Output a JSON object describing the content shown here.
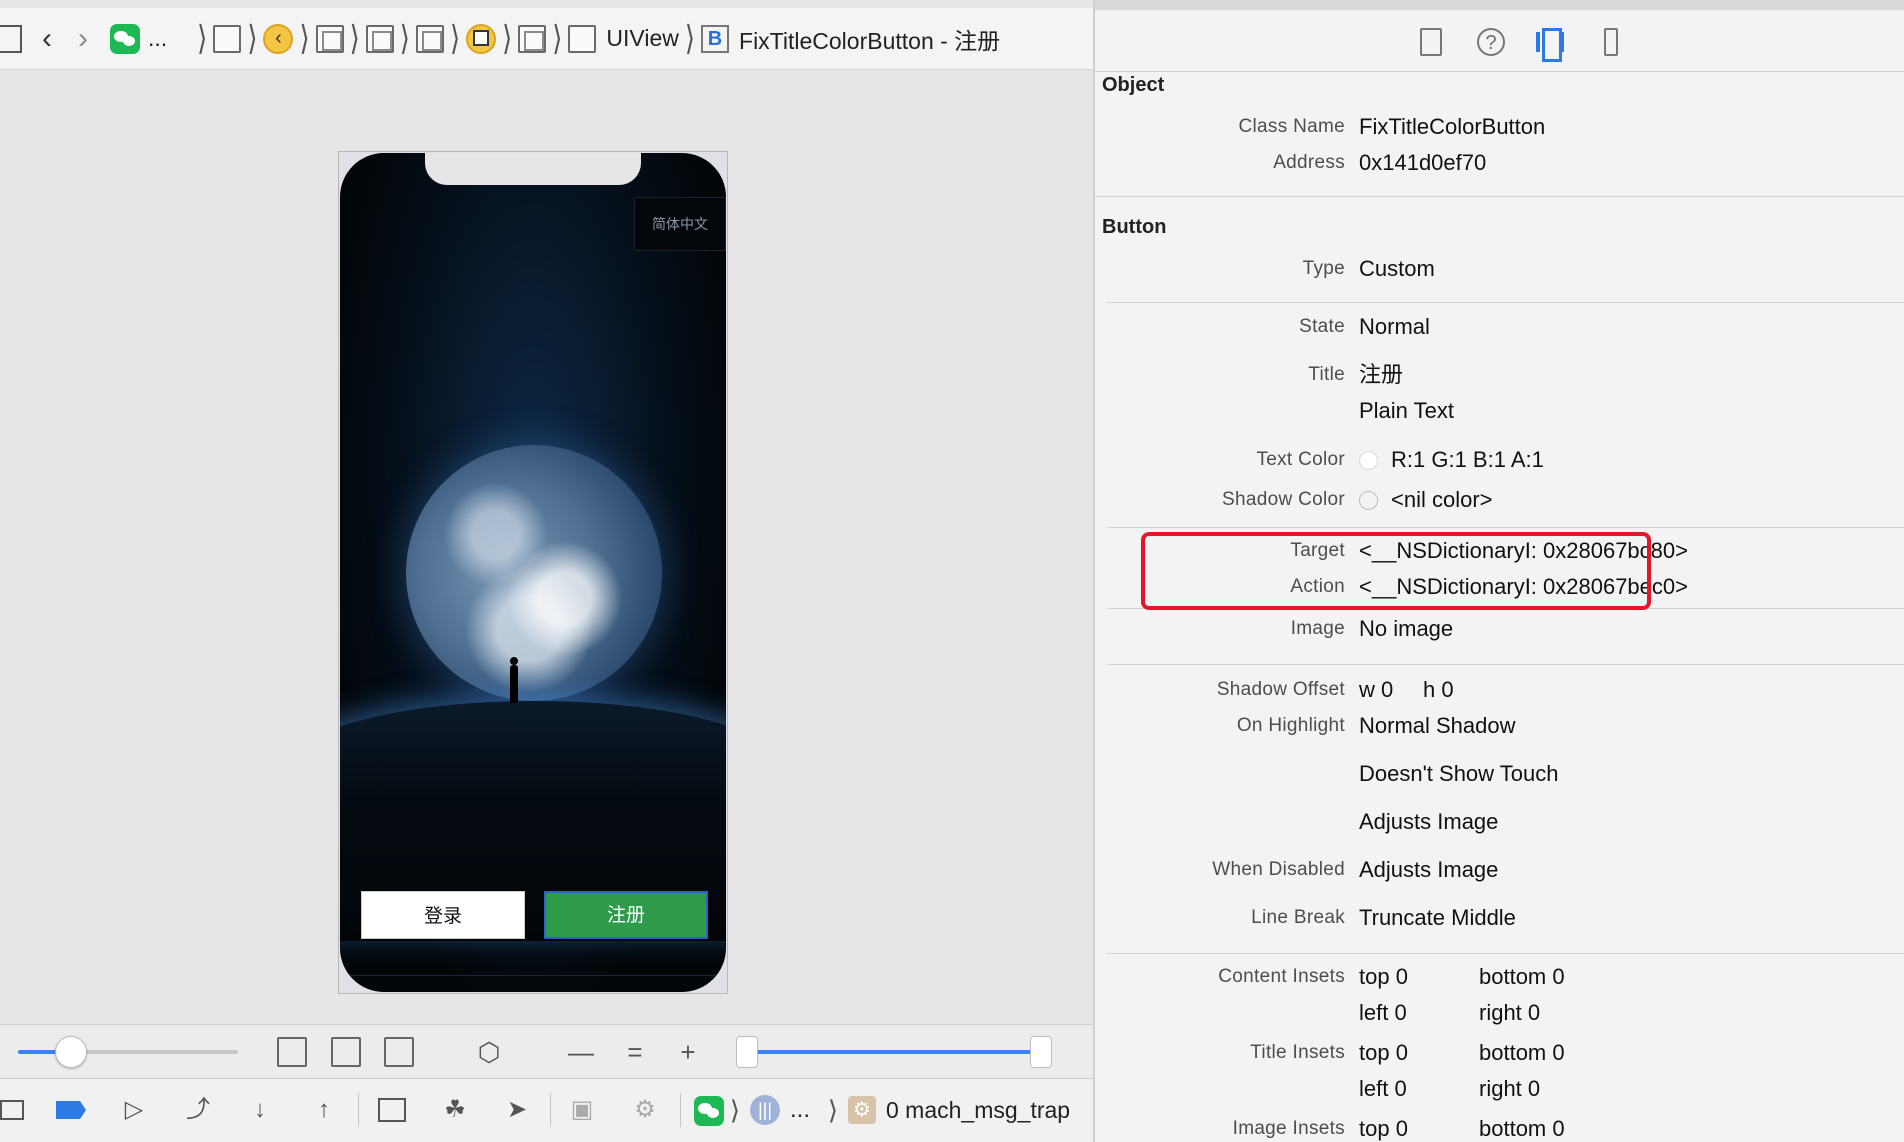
{
  "jumpbar": {
    "app_ellipsis": "...",
    "view_label": "UIView",
    "button_label": "FixTitleColorButton - 注册",
    "b_badge": "B"
  },
  "phone": {
    "lang_button": "简体中文",
    "login_button": "登录",
    "register_button": "注册"
  },
  "debugbar": {
    "ellipsis": "...",
    "thread_label": "0 mach_msg_trap"
  },
  "inspector": {
    "object_section": "Object",
    "class_name_label": "Class Name",
    "class_name_value": "FixTitleColorButton",
    "address_label": "Address",
    "address_value": "0x141d0ef70",
    "button_section": "Button",
    "type_label": "Type",
    "type_value": "Custom",
    "state_label": "State",
    "state_value": "Normal",
    "title_label": "Title",
    "title_value": "注册",
    "title_kind": "Plain Text",
    "text_color_label": "Text Color",
    "text_color_value": "R:1 G:1 B:1 A:1",
    "shadow_color_label": "Shadow Color",
    "shadow_color_value": "<nil color>",
    "target_label": "Target",
    "target_value": "<__NSDictionaryI: 0x28067bc80>",
    "action_label": "Action",
    "action_value": "<__NSDictionaryI: 0x28067bec0>",
    "image_label": "Image",
    "image_value": "No image",
    "shadow_offset_label": "Shadow Offset",
    "shadow_offset_w": "w 0",
    "shadow_offset_h": "h 0",
    "on_highlight_label": "On Highlight",
    "on_highlight_value": "Normal Shadow",
    "doesnt_show_touch": "Doesn't Show Touch",
    "adjusts_image_1": "Adjusts Image",
    "when_disabled_label": "When Disabled",
    "when_disabled_value": "Adjusts Image",
    "line_break_label": "Line Break",
    "line_break_value": "Truncate Middle",
    "content_insets_label": "Content Insets",
    "title_insets_label": "Title Insets",
    "image_insets_label": "Image Insets",
    "top_0": "top 0",
    "bottom_0": "bottom 0",
    "left_0": "left 0",
    "right_0": "right 0"
  },
  "colors": {
    "accent": "#2c7be5",
    "register_green": "#2d9b4a",
    "highlight_red": "#e5162a"
  },
  "icons": [
    "grid-icon",
    "back-icon",
    "forward-icon",
    "wechat-icon",
    "view-icon",
    "back-button-icon",
    "stop-icon",
    "file-inspector-icon",
    "help-icon",
    "view-inspector-icon",
    "size-inspector-icon"
  ]
}
